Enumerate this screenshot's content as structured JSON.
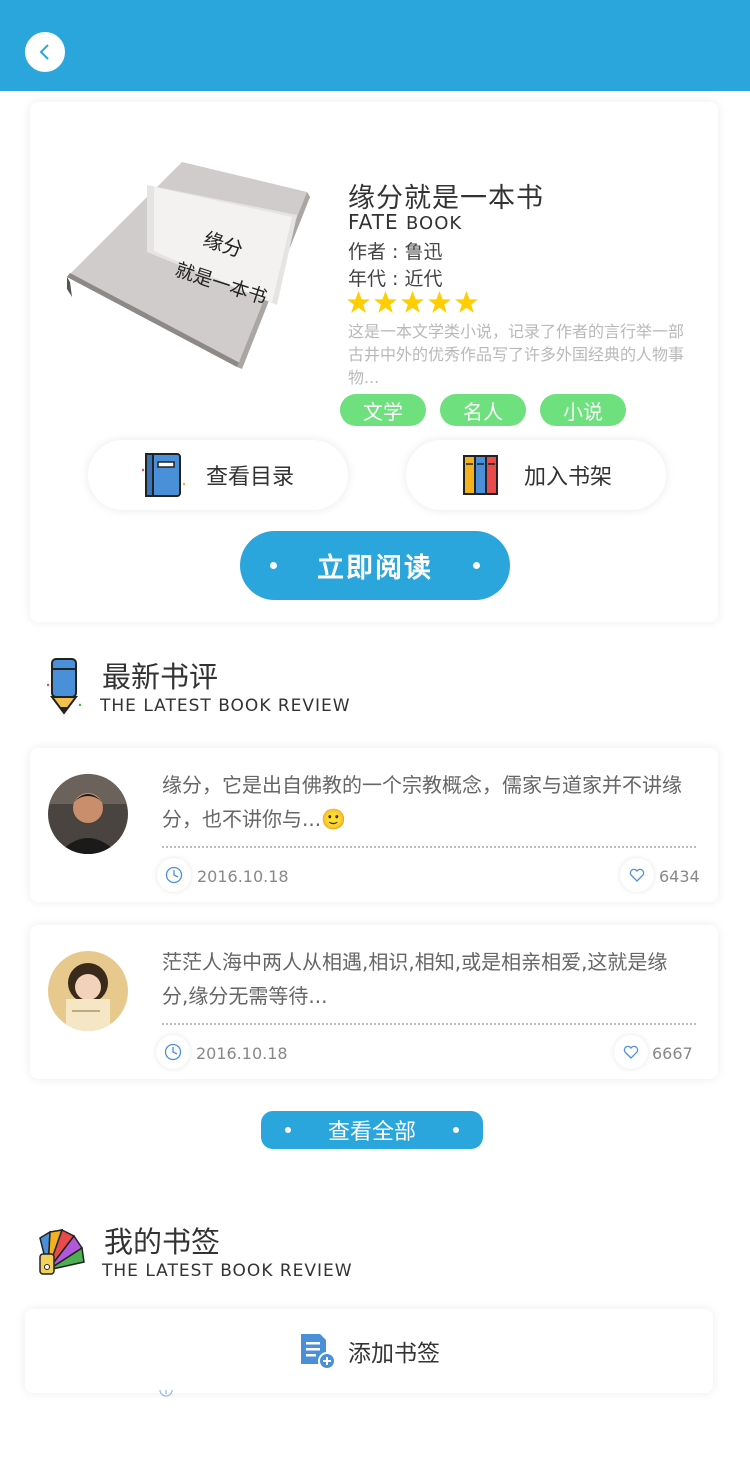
{
  "header": {
    "back_icon": "chevron-left-icon",
    "bg_color": "#2aa6dc"
  },
  "book": {
    "cover_text_line1": "缘分",
    "cover_text_line2": "就是一本书",
    "title": "缘分就是一本书",
    "subtitle_main": "FATE",
    "subtitle_small": "BOOK",
    "author": "作者 : 鲁迅",
    "era": "年代 : 近代",
    "rating": 5,
    "rating_max": 5,
    "description": "这是一本文学类小说，记录了作者的言行举一部古井中外的优秀作品写了许多外国经典的人物事物...",
    "tags": [
      "文学",
      "名人",
      "小说"
    ],
    "tag_color": "#6ee07e",
    "catalog_label": "查看目录",
    "shelf_label": "加入书架",
    "read_label": "立即阅读"
  },
  "reviews_section": {
    "title": "最新书评",
    "subtitle": "THE LATEST BOOK REVIEW",
    "icon": "pencil-icon"
  },
  "reviews": [
    {
      "text": "缘分，它是出自佛教的一个宗教概念，儒家与道家并不讲缘分，也不讲你与...",
      "emoji": "🙂",
      "date": "2016.10.18",
      "likes": "6434"
    },
    {
      "text": "茫茫人海中两人从相遇,相识,相知,或是相亲相爱,这就是缘分,缘分无需等待...",
      "date": "2016.10.18",
      "likes": "6667"
    }
  ],
  "view_all_label": "查看全部",
  "bookmarks_section": {
    "title": "我的书签",
    "subtitle": "THE LATEST BOOK REVIEW",
    "icon": "color-palette-icon"
  },
  "add_bookmark_label": "添加书签",
  "accent_color": "#2aa6dc"
}
